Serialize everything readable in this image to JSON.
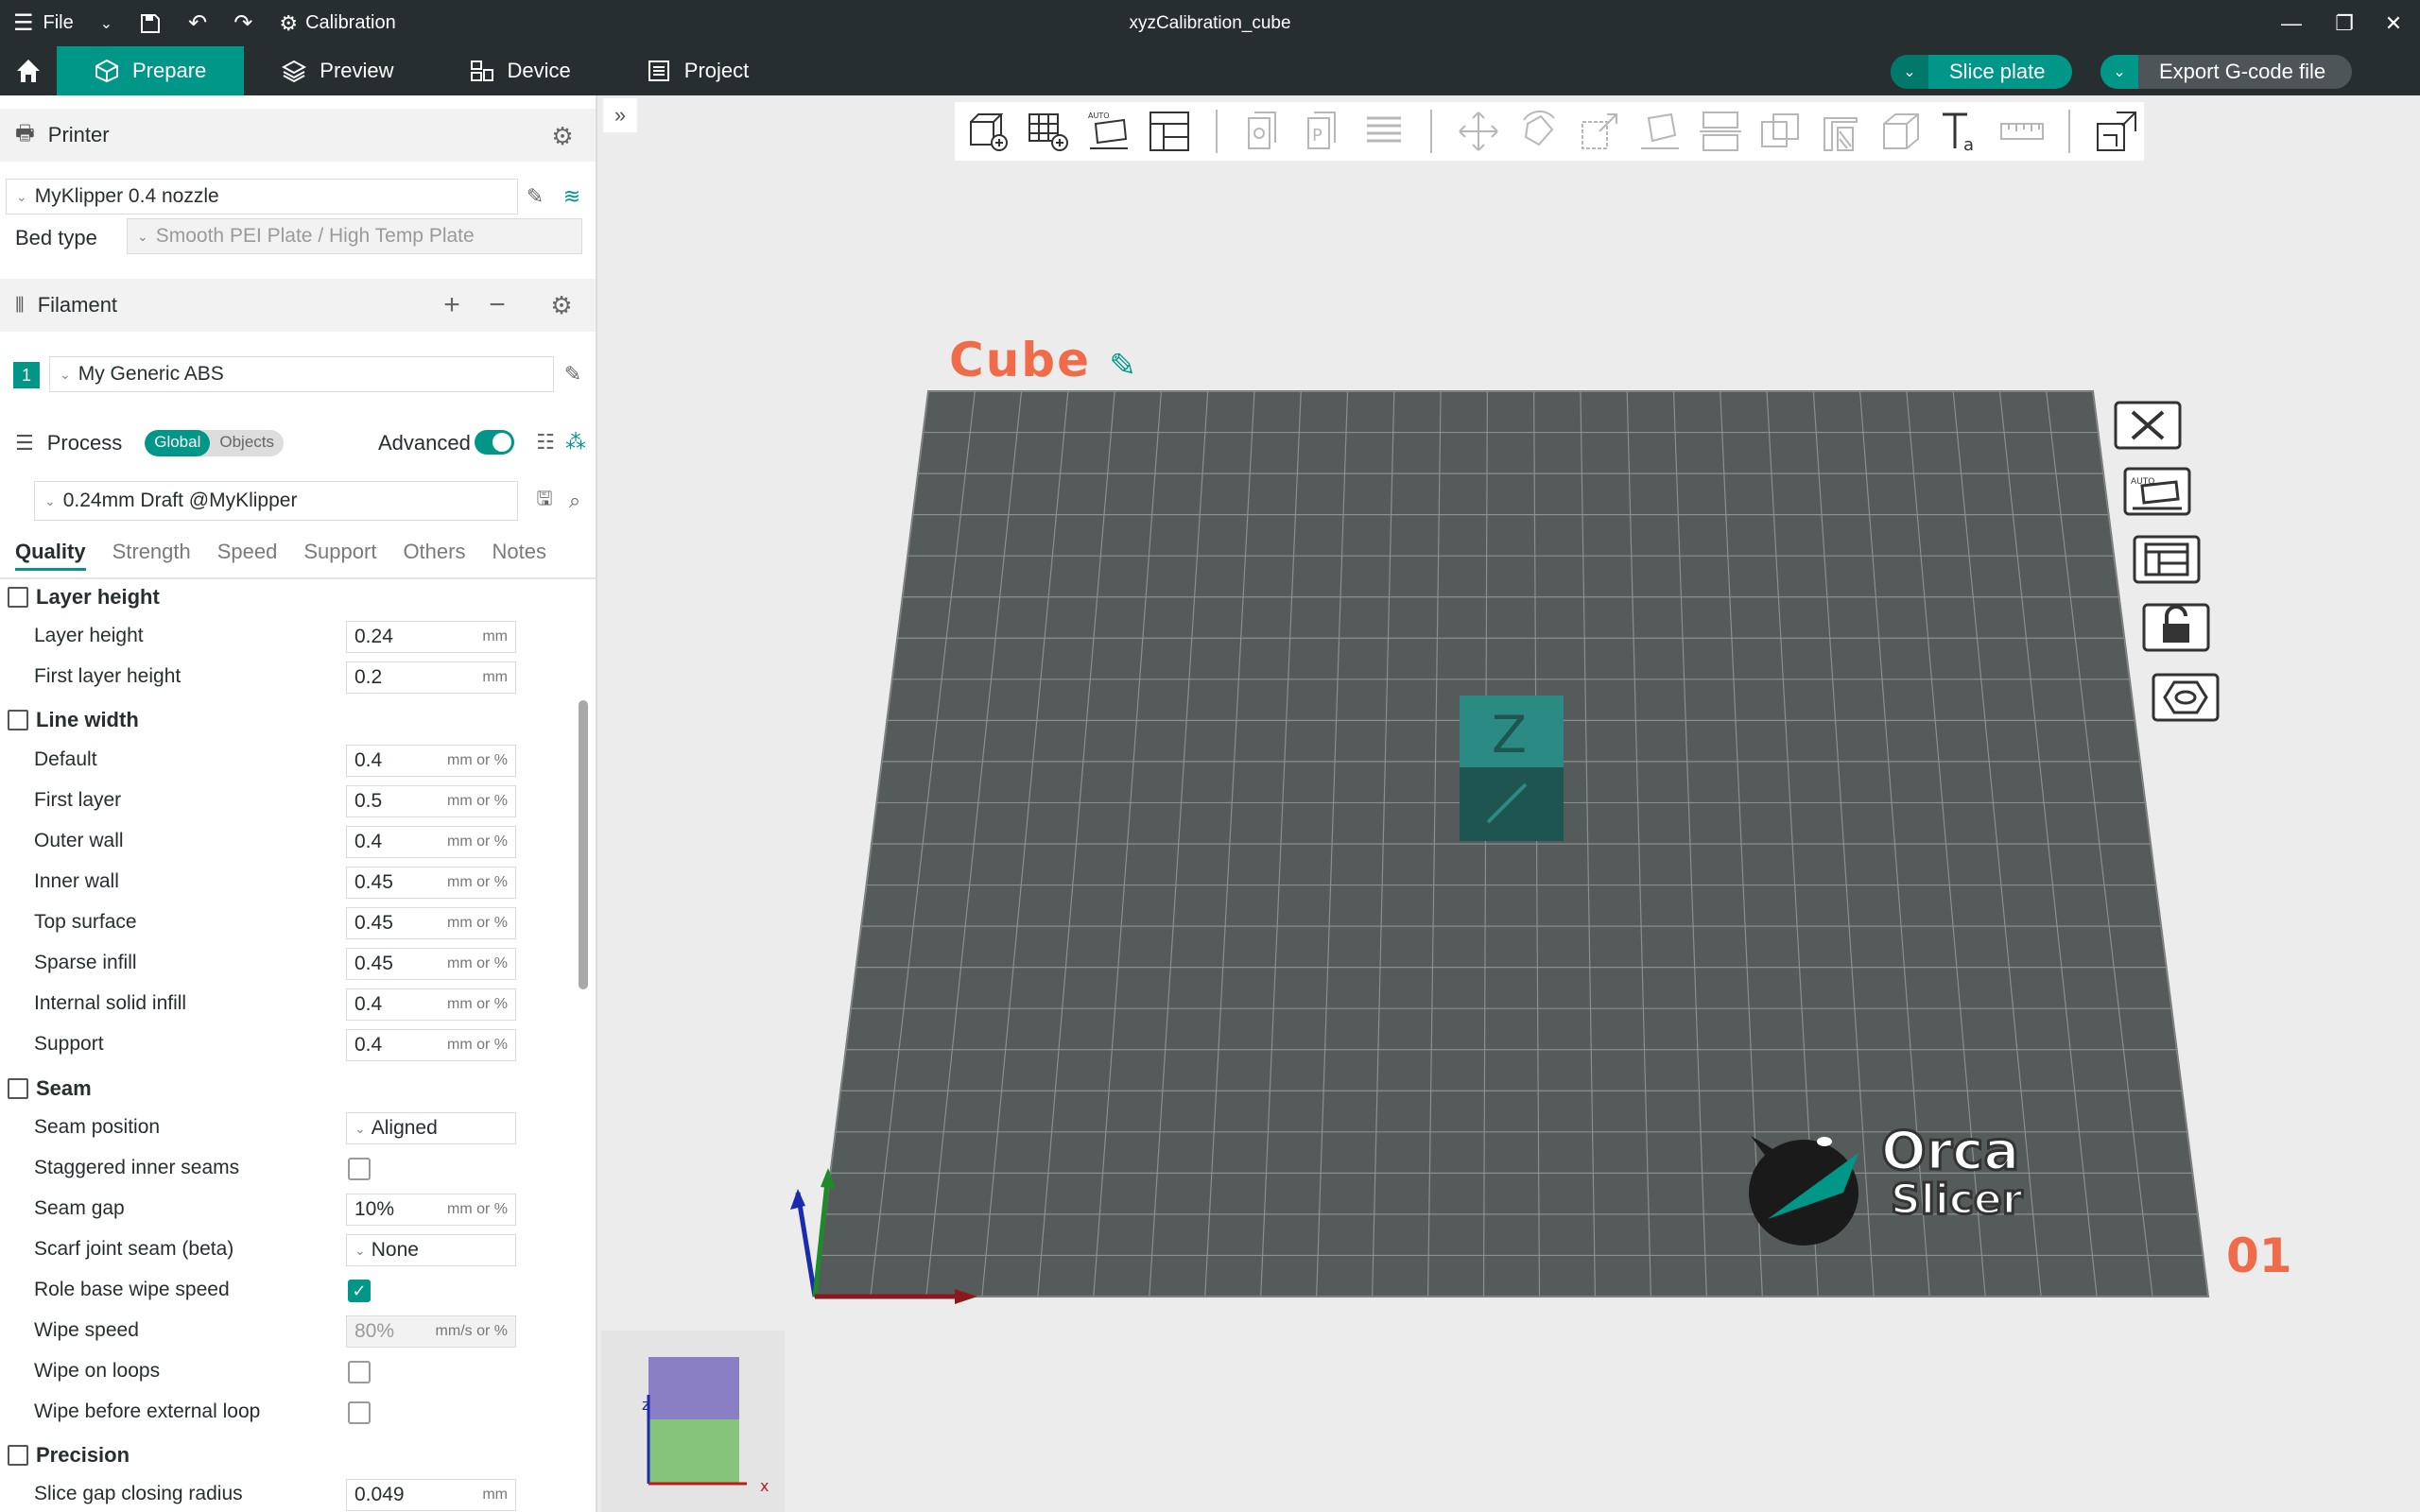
{
  "titlebar": {
    "menu_label": "File",
    "calibration_label": "Calibration",
    "window_title": "xyzCalibration_cube"
  },
  "tabs": [
    {
      "label": "Prepare",
      "icon": "cube-icon",
      "active": true
    },
    {
      "label": "Preview",
      "icon": "layers-icon",
      "active": false
    },
    {
      "label": "Device",
      "icon": "device-icon",
      "active": false
    },
    {
      "label": "Project",
      "icon": "project-icon",
      "active": false
    }
  ],
  "actions": {
    "slice_label": "Slice plate",
    "export_label": "Export G-code file"
  },
  "printer": {
    "section_title": "Printer",
    "selected": "MyKlipper 0.4 nozzle",
    "bed_type_label": "Bed type",
    "bed_type_value": "Smooth PEI Plate / High Temp Plate"
  },
  "filament": {
    "section_title": "Filament",
    "slot_number": "1",
    "selected": "My Generic ABS"
  },
  "process": {
    "section_title": "Process",
    "toggle_global": "Global",
    "toggle_objects": "Objects",
    "advanced_label": "Advanced",
    "preset": "0.24mm Draft @MyKlipper",
    "subtabs": [
      "Quality",
      "Strength",
      "Speed",
      "Support",
      "Others",
      "Notes"
    ]
  },
  "settings": {
    "layer_height_group": "Layer height",
    "layer_height": {
      "label": "Layer height",
      "value": "0.24",
      "unit": "mm"
    },
    "first_layer_height": {
      "label": "First layer height",
      "value": "0.2",
      "unit": "mm"
    },
    "line_width_group": "Line width",
    "lw_default": {
      "label": "Default",
      "value": "0.4",
      "unit": "mm or %"
    },
    "lw_first_layer": {
      "label": "First layer",
      "value": "0.5",
      "unit": "mm or %"
    },
    "lw_outer_wall": {
      "label": "Outer wall",
      "value": "0.4",
      "unit": "mm or %"
    },
    "lw_inner_wall": {
      "label": "Inner wall",
      "value": "0.45",
      "unit": "mm or %"
    },
    "lw_top_surface": {
      "label": "Top surface",
      "value": "0.45",
      "unit": "mm or %"
    },
    "lw_sparse_infill": {
      "label": "Sparse infill",
      "value": "0.45",
      "unit": "mm or %"
    },
    "lw_internal_solid": {
      "label": "Internal solid infill",
      "value": "0.4",
      "unit": "mm or %"
    },
    "lw_support": {
      "label": "Support",
      "value": "0.4",
      "unit": "mm or %"
    },
    "seam_group": "Seam",
    "seam_position": {
      "label": "Seam position",
      "value": "Aligned"
    },
    "staggered_inner_seams": {
      "label": "Staggered inner seams"
    },
    "seam_gap": {
      "label": "Seam gap",
      "value": "10%",
      "unit": "mm or %"
    },
    "scarf_joint": {
      "label": "Scarf joint seam (beta)",
      "value": "None"
    },
    "role_base_wipe": {
      "label": "Role base wipe speed"
    },
    "wipe_speed": {
      "label": "Wipe speed",
      "value": "80%",
      "unit": "mm/s or %"
    },
    "wipe_on_loops": {
      "label": "Wipe on loops"
    },
    "wipe_before_external": {
      "label": "Wipe before external loop"
    },
    "precision_group": "Precision",
    "slice_gap": {
      "label": "Slice gap closing radius",
      "value": "0.049",
      "unit": "mm"
    }
  },
  "plate": {
    "name": "Cube",
    "number": "01",
    "logo_line1": "Orca",
    "logo_line2": "Slicer"
  },
  "cube": {
    "top_letter": "Z"
  },
  "axes_mini": {
    "z_label": "z",
    "x_label": "x"
  },
  "colors": {
    "accent": "#009688",
    "dark": "#262e30",
    "plate_label": "#ef6b4a"
  }
}
